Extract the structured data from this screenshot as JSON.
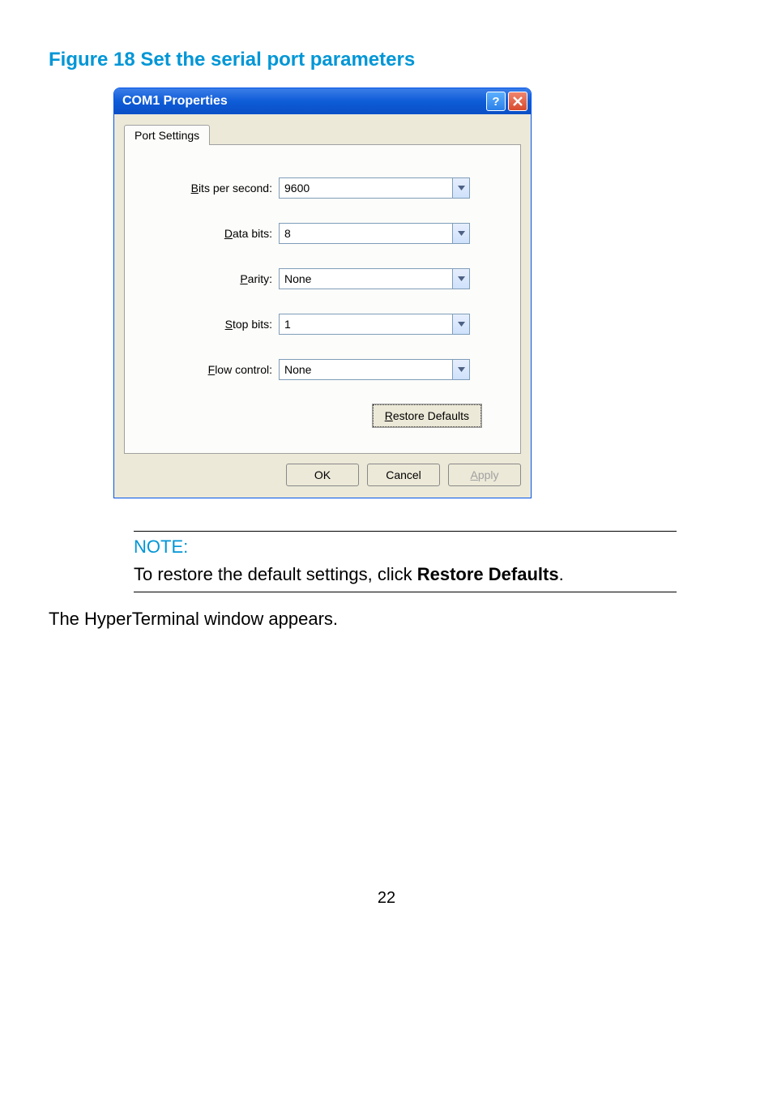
{
  "figure": {
    "title": "Figure 18 Set the serial port parameters"
  },
  "dialog": {
    "title": "COM1 Properties",
    "tab_label": "Port Settings",
    "fields": {
      "bits_per_second": {
        "label_prefix": "B",
        "label_rest": "its per second:",
        "value": "9600"
      },
      "data_bits": {
        "label_prefix": "D",
        "label_rest": "ata bits:",
        "value": "8"
      },
      "parity": {
        "label_prefix": "P",
        "label_rest": "arity:",
        "value": "None"
      },
      "stop_bits": {
        "label_prefix": "S",
        "label_rest": "top bits:",
        "value": "1"
      },
      "flow_control": {
        "label_prefix": "F",
        "label_rest": "low control:",
        "value": "None"
      }
    },
    "restore_prefix": "R",
    "restore_rest": "estore Defaults",
    "ok": "OK",
    "cancel": "Cancel",
    "apply_prefix": "A",
    "apply_rest": "pply"
  },
  "note": {
    "label": "NOTE:",
    "text_before": "To restore the default settings, click ",
    "text_bold": "Restore Defaults",
    "text_after": "."
  },
  "body": {
    "text": "The HyperTerminal window appears."
  },
  "page": "22"
}
